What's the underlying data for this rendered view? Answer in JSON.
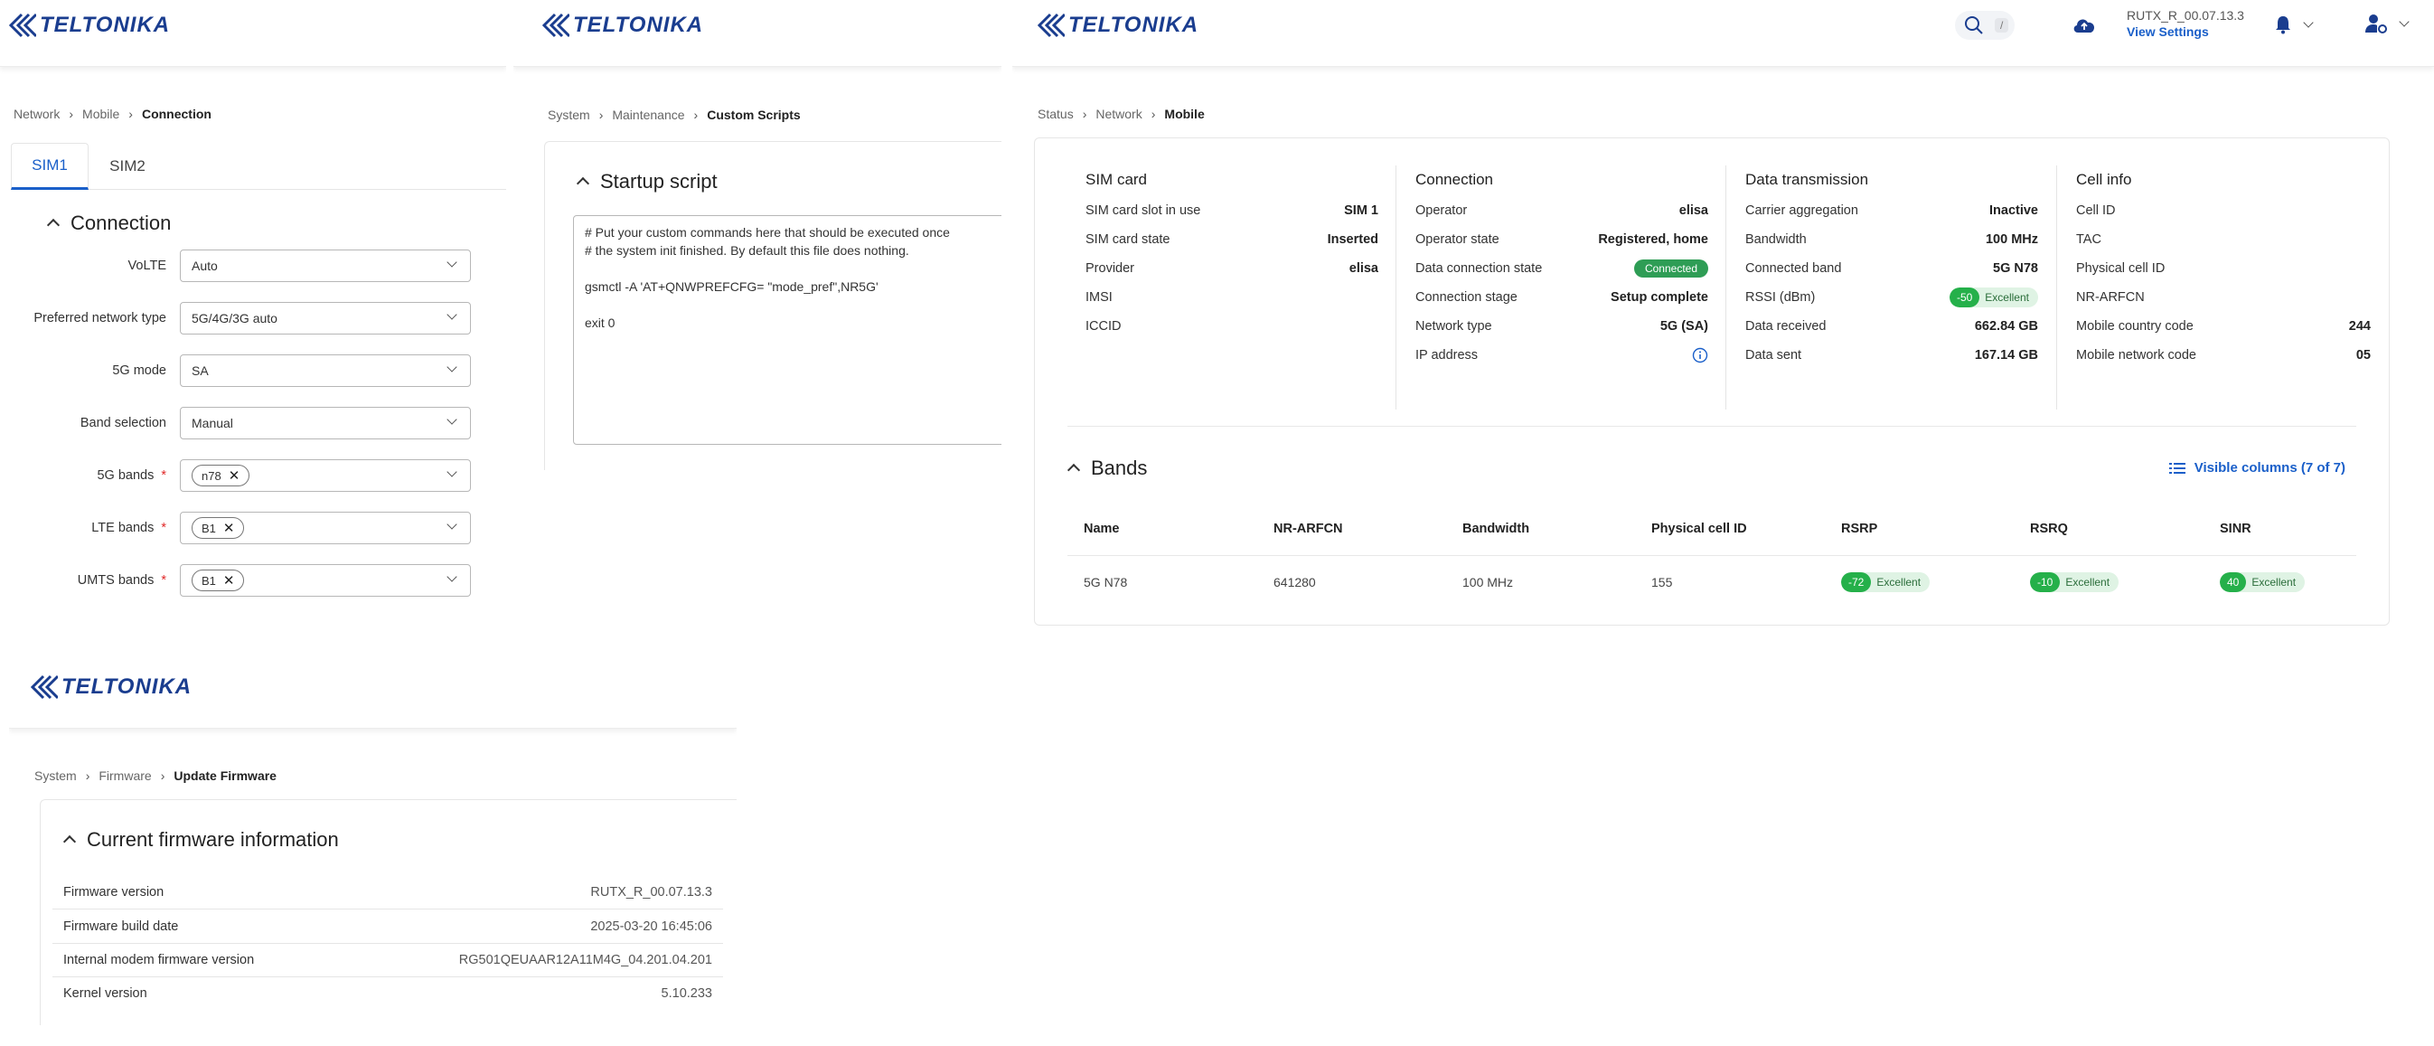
{
  "brand": {
    "logo_text": "TELTONIKA",
    "color": "#1a3d8f",
    "accent": "#1a5fc9"
  },
  "panel_connection": {
    "breadcrumb": [
      "Network",
      "Mobile",
      "Connection"
    ],
    "tabs": [
      "SIM1",
      "SIM2"
    ],
    "active_tab": "SIM1",
    "section_title": "Connection",
    "fields": [
      {
        "label": "VoLTE",
        "value": "Auto",
        "required": false
      },
      {
        "label": "Preferred network type",
        "value": "5G/4G/3G auto",
        "required": false
      },
      {
        "label": "5G mode",
        "value": "SA",
        "required": false
      },
      {
        "label": "Band selection",
        "value": "Manual",
        "required": false
      },
      {
        "label": "5G bands",
        "chip": "n78",
        "required": true
      },
      {
        "label": "LTE bands",
        "chip": "B1",
        "required": true
      },
      {
        "label": "UMTS bands",
        "chip": "B1",
        "required": true
      }
    ],
    "required_mark": "*"
  },
  "panel_scripts": {
    "breadcrumb": [
      "System",
      "Maintenance",
      "Custom Scripts"
    ],
    "section_title": "Startup script",
    "script_text": "# Put your custom commands here that should be executed once\n# the system init finished. By default this file does nothing.\n\ngsmctl -A 'AT+QNWPREFCFG= \"mode_pref\",NR5G'\n\nexit 0"
  },
  "panel_mobile": {
    "header": {
      "search_key": "/",
      "firmware": "RUTX_R_00.07.13.3",
      "view_settings": "View Settings"
    },
    "breadcrumb": [
      "Status",
      "Network",
      "Mobile"
    ],
    "columns": [
      {
        "title": "SIM card",
        "rows": [
          {
            "k": "SIM card slot in use",
            "v": "SIM 1"
          },
          {
            "k": "SIM card state",
            "v": "Inserted"
          },
          {
            "k": "Provider",
            "v": "elisa"
          },
          {
            "k": "IMSI",
            "v": ""
          },
          {
            "k": "ICCID",
            "v": ""
          }
        ]
      },
      {
        "title": "Connection",
        "rows": [
          {
            "k": "Operator",
            "v": "elisa"
          },
          {
            "k": "Operator state",
            "v": "Registered, home"
          },
          {
            "k": "Data connection state",
            "v": "Connected"
          },
          {
            "k": "Connection stage",
            "v": "Setup complete"
          },
          {
            "k": "Network type",
            "v": "5G (SA)"
          },
          {
            "k": "IP address",
            "v": ""
          }
        ]
      },
      {
        "title": "Data transmission",
        "rows": [
          {
            "k": "Carrier aggregation",
            "v": "Inactive"
          },
          {
            "k": "Bandwidth",
            "v": "100 MHz"
          },
          {
            "k": "Connected band",
            "v": "5G N78"
          },
          {
            "k": "RSSI (dBm)",
            "v": "-50",
            "quality": "Excellent"
          },
          {
            "k": "Data received",
            "v": "662.84 GB"
          },
          {
            "k": "Data sent",
            "v": "167.14 GB"
          }
        ]
      },
      {
        "title": "Cell info",
        "rows": [
          {
            "k": "Cell ID",
            "v": ""
          },
          {
            "k": "TAC",
            "v": ""
          },
          {
            "k": "Physical cell ID",
            "v": ""
          },
          {
            "k": "NR-ARFCN",
            "v": ""
          },
          {
            "k": "Mobile country code",
            "v": "244"
          },
          {
            "k": "Mobile network code",
            "v": "05"
          }
        ]
      }
    ],
    "bands": {
      "title": "Bands",
      "visible_columns": "Visible columns (7 of 7)",
      "headers": [
        "Name",
        "NR-ARFCN",
        "Bandwidth",
        "Physical cell ID",
        "RSRP",
        "RSRQ",
        "SINR"
      ],
      "row": {
        "name": "5G N78",
        "arfcn": "641280",
        "bandwidth": "100 MHz",
        "pci": "155",
        "rsrp": "-72",
        "rsrq": "-10",
        "sinr": "40",
        "quality": "Excellent"
      }
    }
  },
  "panel_firmware": {
    "breadcrumb": [
      "System",
      "Firmware",
      "Update Firmware"
    ],
    "section_title": "Current firmware information",
    "rows": [
      {
        "k": "Firmware version",
        "v": "RUTX_R_00.07.13.3"
      },
      {
        "k": "Firmware build date",
        "v": "2025-03-20 16:45:06"
      },
      {
        "k": "Internal modem firmware version",
        "v": "RG501QEUAAR12A11M4G_04.201.04.201"
      },
      {
        "k": "Kernel version",
        "v": "5.10.233"
      }
    ]
  }
}
